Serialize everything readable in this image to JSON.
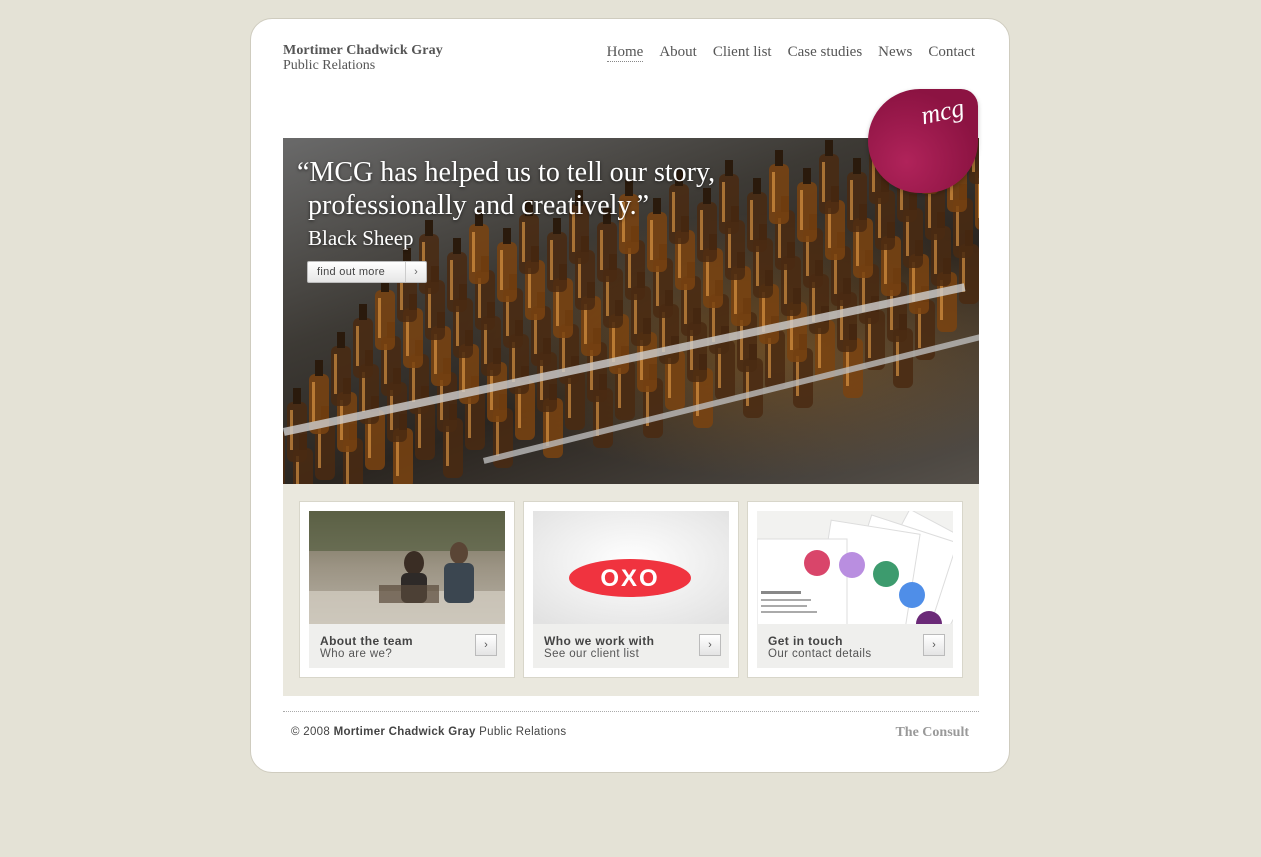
{
  "brand": {
    "name": "Mortimer Chadwick Gray",
    "subtitle": "Public Relations"
  },
  "nav": {
    "items": [
      "Home",
      "About",
      "Client list",
      "Case studies",
      "News",
      "Contact"
    ],
    "active": "Home"
  },
  "logo": {
    "text": "mcg",
    "color": "#9c1a4e"
  },
  "hero": {
    "quote_line1": "“MCG has helped us to tell our story,",
    "quote_line2": "professionally and creatively.”",
    "source": "Black Sheep",
    "button_label": "find out more",
    "button_arrow": "›"
  },
  "panels": [
    {
      "title": "About the team",
      "subtitle": "Who are we?",
      "arrow": "›"
    },
    {
      "title": "Who we work with",
      "subtitle": "See our client list",
      "arrow": "›",
      "logo_text": "OXO"
    },
    {
      "title": "Get in touch",
      "subtitle": "Our contact details",
      "arrow": "›"
    }
  ],
  "footer": {
    "copyright_prefix": "© 2008",
    "copyright_name": "Mortimer Chadwick Gray",
    "copyright_suffix": "Public Relations",
    "credit": "The Consult"
  }
}
